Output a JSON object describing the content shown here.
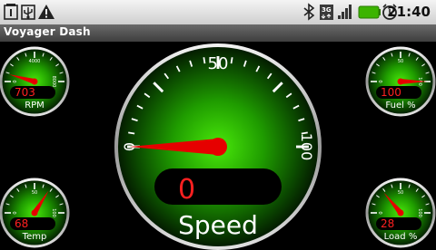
{
  "app": {
    "title": "Voyager Dash"
  },
  "status_bar": {
    "clock": "21:40",
    "left_icons": [
      "sim-notification-icon",
      "usb-debug-icon",
      "warning-icon"
    ],
    "right_icons": [
      "bluetooth-icon",
      "3g-data-icon",
      "signal-icon",
      "battery-icon",
      "alarm-icon"
    ],
    "battery_color": "#3cb400"
  },
  "colors": {
    "needle": "#e60000",
    "readout_text": "#ff2020",
    "gauge_glow": "#29c400",
    "background": "#000000"
  },
  "gauges": {
    "rpm": {
      "label": "RPM",
      "value": 703,
      "display": "703",
      "min": 0,
      "max": 8000,
      "ticks": [
        "0",
        "4000",
        "8000"
      ]
    },
    "speed": {
      "label": "Speed",
      "value": 0,
      "display": "0",
      "min": 0,
      "max": 100,
      "ticks": [
        "0",
        "50",
        "100"
      ]
    },
    "fuel": {
      "label": "Fuel %",
      "value": 100,
      "display": "100",
      "min": 0,
      "max": 100,
      "ticks": [
        "0",
        "50",
        "100"
      ]
    },
    "temp": {
      "label": "Temp",
      "value": 68,
      "display": "68",
      "min": 0,
      "max": 100,
      "ticks": [
        "0",
        "50",
        "100"
      ]
    },
    "load": {
      "label": "Load %",
      "value": 28,
      "display": "28",
      "min": 0,
      "max": 100,
      "ticks": [
        "0",
        "50",
        "100"
      ]
    }
  }
}
